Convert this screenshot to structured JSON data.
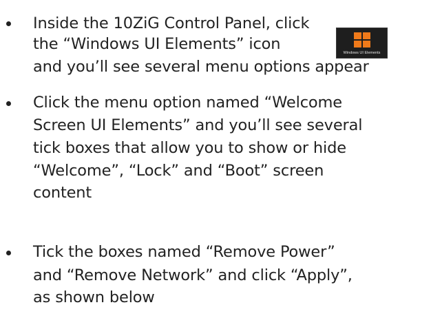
{
  "bullets": [
    {
      "lines": [
        "Inside the 10ZiG Control Panel, click",
        "the “Windows UI Elements” icon",
        "and you’ll see several menu options appear"
      ]
    },
    {
      "lines": [
        "Click the menu option named “Welcome",
        "Screen UI Elements” and you’ll see several",
        "tick boxes that allow you to show or hide",
        "“Welcome”, “Lock” and “Boot” screen",
        "content"
      ]
    },
    {
      "lines": [
        "Tick the boxes named “Remove Power”",
        "and “Remove Network” and click “Apply”,",
        "as shown below"
      ]
    }
  ],
  "inline_icon": {
    "icon": "windows-logo-icon",
    "caption": "Windows UI Elements",
    "accent_color": "#f07a1a",
    "background_color": "#1e1e1e"
  }
}
